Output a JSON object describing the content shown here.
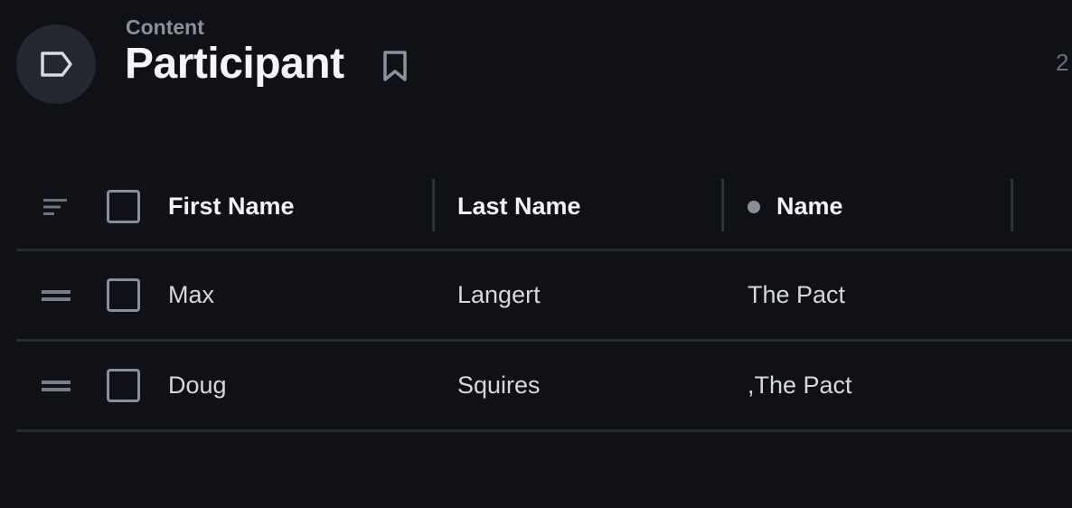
{
  "header": {
    "breadcrumb": "Content",
    "title": "Participant",
    "count": "2"
  },
  "table": {
    "columns": [
      {
        "label": "First Name"
      },
      {
        "label": "Last Name"
      },
      {
        "label": "Name"
      }
    ],
    "rows": [
      {
        "first_name": "Max",
        "last_name": "Langert",
        "name": "The Pact"
      },
      {
        "first_name": "Doug",
        "last_name": "Squires",
        "name": ",The Pact"
      }
    ]
  },
  "icons": {
    "type": "tag-icon",
    "bookmark": "bookmark-icon",
    "sort": "sort-icon",
    "drag": "drag-handle-icon"
  },
  "colors": {
    "background": "#0f1116",
    "icon_circle": "#23272e",
    "divider": "#262a31",
    "muted_text": "#8c9099"
  }
}
